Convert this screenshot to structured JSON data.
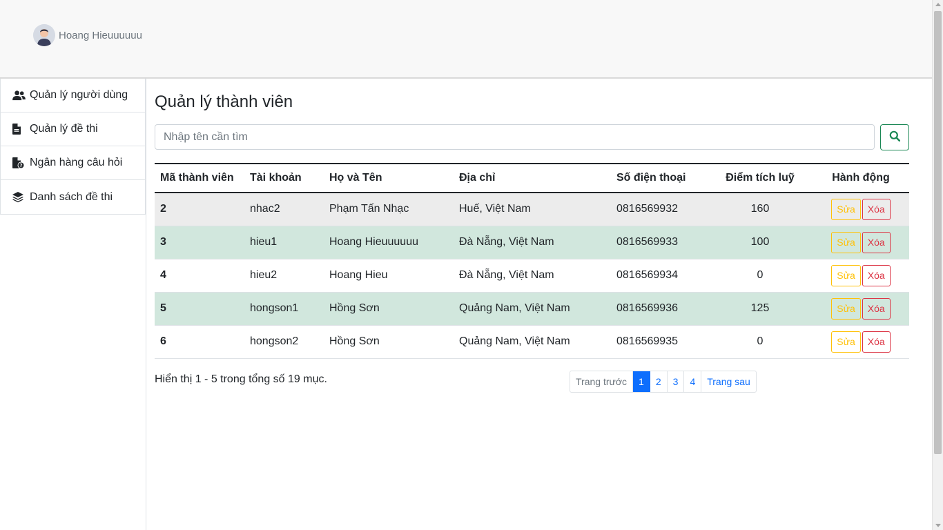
{
  "header": {
    "username": "Hoang Hieuuuuuu"
  },
  "sidebar": {
    "items": [
      {
        "label": "Quản lý người dùng",
        "icon": "users-icon"
      },
      {
        "label": "Quản lý đề thi",
        "icon": "file-icon"
      },
      {
        "label": "Ngân hàng câu hỏi",
        "icon": "file-question-icon"
      },
      {
        "label": "Danh sách đề thi",
        "icon": "layers-icon"
      }
    ]
  },
  "main": {
    "title": "Quản lý thành viên",
    "search": {
      "placeholder": "Nhập tên cần tìm",
      "value": ""
    },
    "table": {
      "columns": [
        "Mã thành viên",
        "Tài khoản",
        "Họ và Tên",
        "Địa chỉ",
        "Số điện thoại",
        "Điểm tích luỹ",
        "Hành động"
      ],
      "rows": [
        {
          "id": "2",
          "account": "nhac2",
          "name": "Phạm Tấn Nhạc",
          "address": "Huế, Việt Nam",
          "phone": "0816569932",
          "points": "160"
        },
        {
          "id": "3",
          "account": "hieu1",
          "name": "Hoang Hieuuuuuu",
          "address": "Đà Nẵng, Việt Nam",
          "phone": "0816569933",
          "points": "100"
        },
        {
          "id": "4",
          "account": "hieu2",
          "name": "Hoang Hieu",
          "address": "Đà Nẵng, Việt Nam",
          "phone": "0816569934",
          "points": "0"
        },
        {
          "id": "5",
          "account": "hongson1",
          "name": "Hồng Sơn",
          "address": "Quảng Nam, Việt Nam",
          "phone": "0816569936",
          "points": "125"
        },
        {
          "id": "6",
          "account": "hongson2",
          "name": "Hồng Sơn",
          "address": "Quảng Nam, Việt Nam",
          "phone": "0816569935",
          "points": "0"
        }
      ],
      "edit_label": "Sửa",
      "delete_label": "Xóa"
    },
    "summary": "Hiển thị 1 - 5 trong tổng số 19 mục.",
    "pagination": {
      "prev": "Trang trước",
      "pages": [
        "1",
        "2",
        "3",
        "4"
      ],
      "next": "Trang sau",
      "active": "1"
    }
  },
  "colors": {
    "primary": "#0d6efd",
    "success": "#198754",
    "warning": "#ffc107",
    "danger": "#dc3545",
    "row_highlight": "#d1e7dd"
  }
}
